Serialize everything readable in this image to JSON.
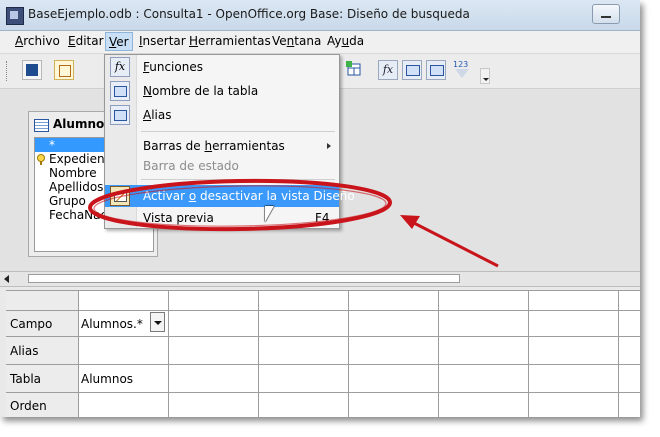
{
  "window": {
    "title": "BaseEjemplo.odb : Consulta1 - OpenOffice.org Base: Diseño de busqueda"
  },
  "menubar": [
    {
      "pre": "",
      "mn": "A",
      "post": "rchivo"
    },
    {
      "pre": "",
      "mn": "E",
      "post": "ditar"
    },
    {
      "pre": "",
      "mn": "V",
      "post": "er"
    },
    {
      "pre": "",
      "mn": "I",
      "post": "nsertar"
    },
    {
      "pre": "",
      "mn": "H",
      "post": "erramientas"
    },
    {
      "pre": "Ve",
      "mn": "n",
      "post": "tana"
    },
    {
      "pre": "Ay",
      "mn": "u",
      "post": "da"
    }
  ],
  "view_menu": {
    "items": [
      {
        "pre": "",
        "mn": "F",
        "post": "unciones",
        "icon": "functions-icon",
        "state": "normal"
      },
      {
        "pre": "",
        "mn": "N",
        "post": "ombre de la tabla",
        "icon": "table-name-icon",
        "state": "normal"
      },
      {
        "pre": "",
        "mn": "A",
        "post": "lias",
        "icon": "alias-icon",
        "state": "normal"
      },
      {
        "pre": "Barras de ",
        "mn": "h",
        "post": "erramientas",
        "state": "normal",
        "submenu": true
      },
      {
        "pre": "Barra de estado",
        "mn": "",
        "post": "",
        "state": "disabled"
      },
      {
        "pre": "Activar ",
        "mn": "o",
        "post": " desactivar la vista Diseño",
        "icon": "design-view-icon",
        "state": "highlighted"
      },
      {
        "pre": "Vista previa",
        "mn": "",
        "post": "",
        "shortcut": "F4",
        "state": "normal"
      }
    ]
  },
  "table_window": {
    "title": "Alumnos",
    "fields": [
      "*",
      "Expediente",
      "Nombre",
      "Apellidos",
      "Grupo",
      "FechaNac"
    ]
  },
  "design_grid": {
    "row_labels": [
      "Campo",
      "Alias",
      "Tabla",
      "Orden"
    ],
    "campo_value": "Alumnos.*",
    "tabla_value": "Alumnos"
  },
  "toolbar": {
    "fx_label": "fx",
    "filter_badge": "123"
  },
  "colors": {
    "highlight": "#3b99fc",
    "annotation": "#c8141a"
  }
}
